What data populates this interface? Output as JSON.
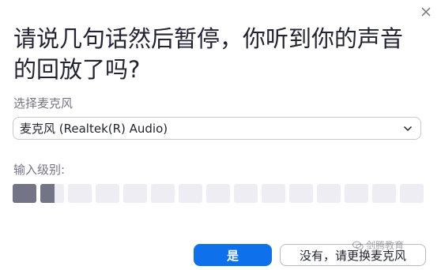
{
  "dialog": {
    "title": "请说几句话然后暂停，你听到你的声音的回放了吗?",
    "mic_label": "选择麦克风",
    "mic_selected": "麦克风 (Realtek(R) Audio)",
    "input_level_label": "输入级别:",
    "input_level": {
      "segments_total": 15,
      "segments_lit": 1.6
    },
    "yes_button": "是",
    "no_button": "没有，请更换麦克风"
  },
  "icons": {
    "close": "close-icon",
    "dropdown": "chevron-down-icon",
    "watermark": "wechat-icon"
  },
  "watermark": {
    "text": "剑腾教育"
  },
  "colors": {
    "accent": "#0e71eb",
    "meter_on": "#747487",
    "meter_off": "#ededf3",
    "text": "#232333",
    "muted": "#747487"
  }
}
